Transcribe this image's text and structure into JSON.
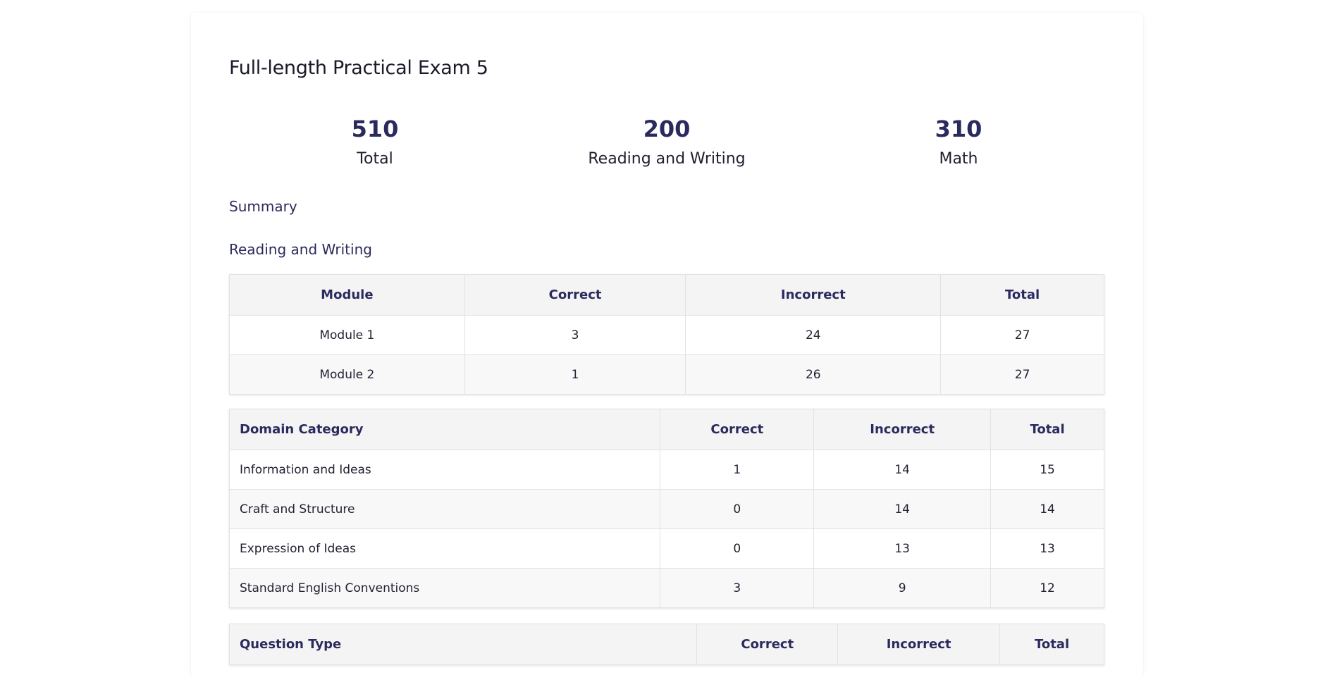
{
  "exam": {
    "title": "Full-length Practical Exam 5"
  },
  "scores": [
    {
      "value": "510",
      "label": "Total"
    },
    {
      "value": "200",
      "label": "Reading and Writing"
    },
    {
      "value": "310",
      "label": "Math"
    }
  ],
  "summary_heading": "Summary",
  "reading_writing_heading": "Reading and Writing",
  "module_table": {
    "headers": [
      "Module",
      "Correct",
      "Incorrect",
      "Total"
    ],
    "rows": [
      [
        "Module 1",
        "3",
        "24",
        "27"
      ],
      [
        "Module 2",
        "1",
        "26",
        "27"
      ]
    ]
  },
  "domain_table": {
    "headers": [
      "Domain Category",
      "Correct",
      "Incorrect",
      "Total"
    ],
    "rows": [
      [
        "Information and Ideas",
        "1",
        "14",
        "15"
      ],
      [
        "Craft and Structure",
        "0",
        "14",
        "14"
      ],
      [
        "Expression of Ideas",
        "0",
        "13",
        "13"
      ],
      [
        "Standard English Conventions",
        "3",
        "9",
        "12"
      ]
    ]
  },
  "question_type_table": {
    "headers": [
      "Question Type",
      "Correct",
      "Incorrect",
      "Total"
    ]
  }
}
